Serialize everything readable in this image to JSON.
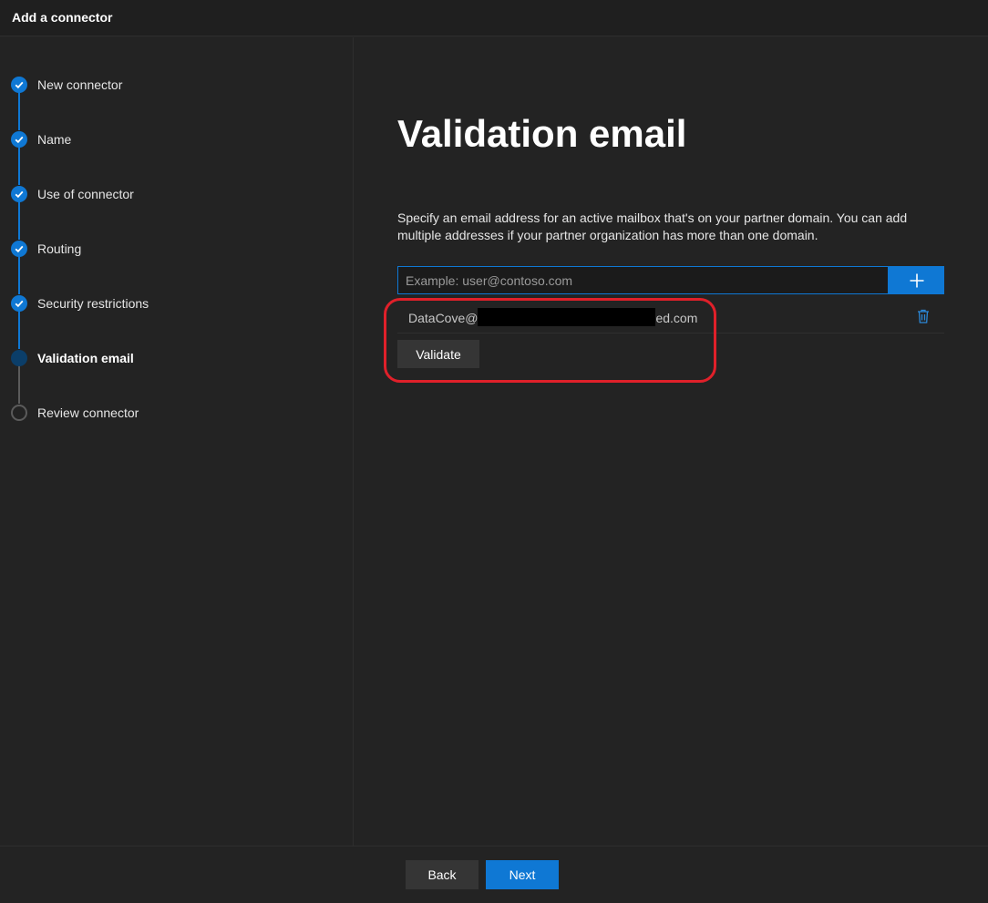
{
  "header": {
    "title": "Add a connector"
  },
  "steps": [
    {
      "label": "New connector",
      "state": "done"
    },
    {
      "label": "Name",
      "state": "done"
    },
    {
      "label": "Use of connector",
      "state": "done"
    },
    {
      "label": "Routing",
      "state": "done"
    },
    {
      "label": "Security restrictions",
      "state": "done"
    },
    {
      "label": "Validation email",
      "state": "current"
    },
    {
      "label": "Review connector",
      "state": "todo"
    }
  ],
  "main": {
    "title": "Validation email",
    "description": "Specify an email address for an active mailbox that's on your partner domain. You can add multiple addresses if your partner organization has more than one domain.",
    "email_input": {
      "placeholder": "Example: user@contoso.com",
      "value": ""
    },
    "emails": [
      {
        "prefix": "DataCove@",
        "suffix": "ed.com"
      }
    ],
    "validate_label": "Validate"
  },
  "footer": {
    "back_label": "Back",
    "next_label": "Next"
  },
  "colors": {
    "accent": "#0f78d4",
    "highlight": "#e0202a",
    "background": "#232323"
  },
  "icons": {
    "step_done": "check-icon",
    "add": "plus-icon",
    "delete": "trash-icon"
  }
}
